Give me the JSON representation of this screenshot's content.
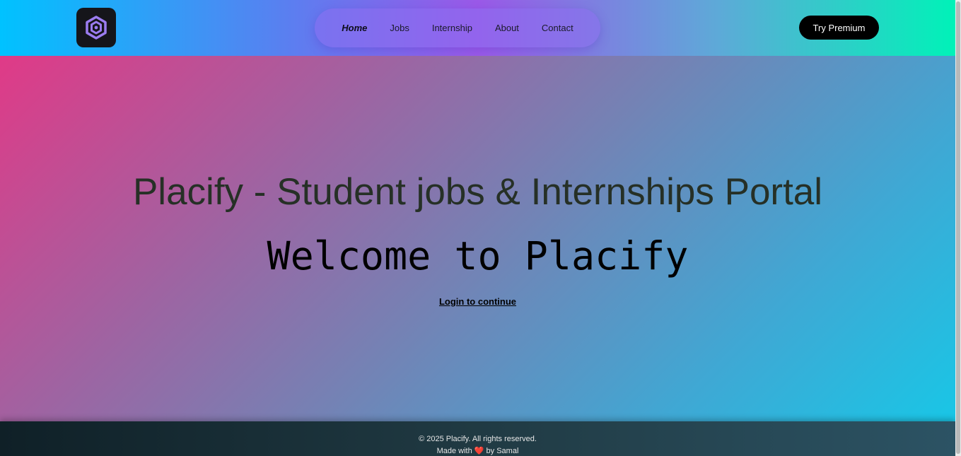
{
  "header": {
    "logo_icon": "hexagon-logo-icon",
    "nav": [
      {
        "label": "Home",
        "active": true
      },
      {
        "label": "Jobs",
        "active": false
      },
      {
        "label": "Internship",
        "active": false
      },
      {
        "label": "About",
        "active": false
      },
      {
        "label": "Contact",
        "active": false
      }
    ],
    "premium_label": "Try Premium"
  },
  "hero": {
    "title": "Placify - Student jobs & Internships Portal",
    "welcome": "Welcome to Placify",
    "login_link": "Login to continue"
  },
  "footer": {
    "copyright": "© 2025 Placify. All rights reserved.",
    "made_with_prefix": "Made with",
    "heart_icon": "heart-icon",
    "made_with_suffix": "by Samal"
  },
  "colors": {
    "logo_bg": "#15151a",
    "logo_accent": "#9b7cf0",
    "premium_bg": "#000000",
    "heart": "#e02424"
  }
}
